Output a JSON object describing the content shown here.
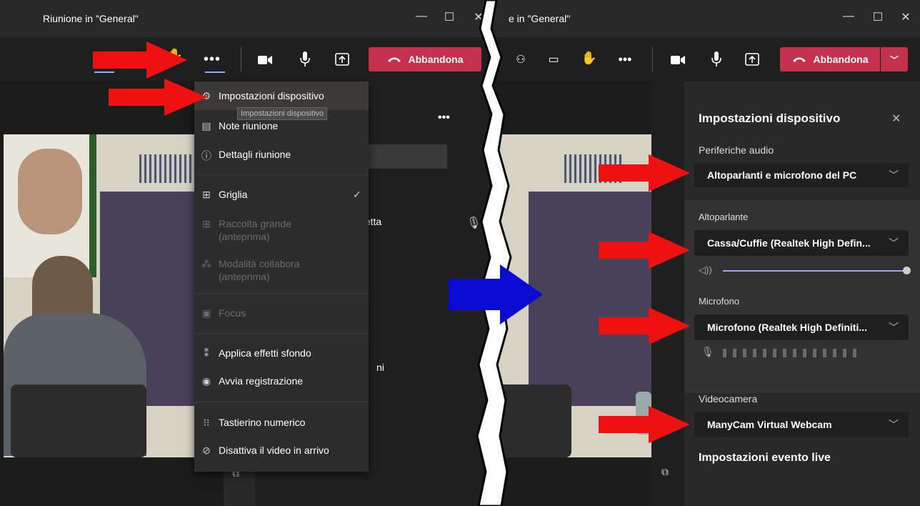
{
  "left_window": {
    "title": "Riunione in \"General\"",
    "leave_label": "Abbandona",
    "more_icon": "more-dots-icon"
  },
  "right_window": {
    "title": "e in \"General\"",
    "leave_label": "Abbandona"
  },
  "menu": {
    "items": [
      {
        "label": "Impostazioni dispositivo",
        "icon": "gear-icon",
        "enabled": true
      },
      {
        "label": "Note riunione",
        "icon": "notes-icon",
        "enabled": true
      },
      {
        "label": "Dettagli riunione",
        "icon": "info-icon",
        "enabled": true
      },
      {
        "label": "Griglia",
        "icon": "grid-icon",
        "enabled": true,
        "checked": true
      },
      {
        "label": "Raccolta grande\n(anteprima)",
        "icon": "gallery-icon",
        "enabled": false
      },
      {
        "label": "Modalità collabora\n(anteprima)",
        "icon": "together-icon",
        "enabled": false
      },
      {
        "label": "Focus",
        "icon": "focus-icon",
        "enabled": false
      },
      {
        "label": "Applica effetti sfondo",
        "icon": "background-effects-icon",
        "enabled": true
      },
      {
        "label": "Avvia registrazione",
        "icon": "record-icon",
        "enabled": true
      },
      {
        "label": "Tastierino numerico",
        "icon": "dialpad-icon",
        "enabled": true
      },
      {
        "label": "Disattiva il video in arrivo",
        "icon": "video-off-icon",
        "enabled": true
      }
    ],
    "tooltip": "Impostazioni dispositivo"
  },
  "behind_panel": {
    "text_netta": "netta",
    "text_ni": "ni"
  },
  "device_settings": {
    "title": "Impostazioni dispositivo",
    "audio_devices_label": "Periferiche audio",
    "audio_devices_value": "Altoparlanti e microfono del PC",
    "speaker_label": "Altoparlante",
    "speaker_value": "Cassa/Cuffie (Realtek High Defin...",
    "speaker_volume": 1.0,
    "mic_label": "Microfono",
    "mic_value": "Microfono (Realtek High Definiti...",
    "camera_label": "Videocamera",
    "camera_value": "ManyCam Virtual Webcam",
    "live_event_title": "Impostazioni evento live"
  },
  "colors": {
    "leave_red": "#c4314b",
    "annotation_red": "#ee1111",
    "annotation_blue": "#0a0ad0",
    "slider": "#9ea2ff"
  }
}
